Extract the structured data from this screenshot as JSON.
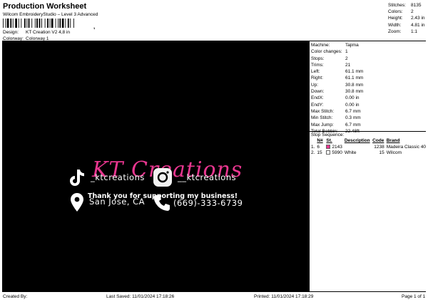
{
  "header": {
    "title": "Production Worksheet",
    "software": "Wilcom EmbroideryStudio – Level 3 Advanced",
    "barcode_mark": ",",
    "design_label": "Design:",
    "design_value": "KT Creation V2 4,8 in",
    "colorway_label": "Colorway:",
    "colorway_value": "Colorway 1"
  },
  "stats": [
    {
      "label": "Stitches:",
      "value": "8135"
    },
    {
      "label": "Colors:",
      "value": "2"
    },
    {
      "label": "Height:",
      "value": "2.43 in"
    },
    {
      "label": "Width:",
      "value": "4.81 in"
    },
    {
      "label": "Zoom:",
      "value": "1:1"
    }
  ],
  "machine": [
    {
      "label": "Machine:",
      "value": "Tajima"
    },
    {
      "label": "Color changes:",
      "value": "1"
    },
    {
      "label": "Stops:",
      "value": "2"
    },
    {
      "label": "Trims:",
      "value": "21"
    },
    {
      "label": "Left:",
      "value": "61.1 mm"
    },
    {
      "label": "Right:",
      "value": "61.1 mm"
    },
    {
      "label": "Up:",
      "value": "30.8 mm"
    },
    {
      "label": "Down:",
      "value": "30.8 mm"
    },
    {
      "label": "EndX:",
      "value": "0.00 in"
    },
    {
      "label": "EndY:",
      "value": "0.00 in"
    },
    {
      "label": "Max Stitch:",
      "value": "6.7 mm"
    },
    {
      "label": "Min Stitch:",
      "value": "0.3 mm"
    },
    {
      "label": "Max Jump:",
      "value": "6.7 mm"
    },
    {
      "label": "Total Bobbin:",
      "value": "22.48ft"
    }
  ],
  "stop_sequence": {
    "title": "Stop Sequence:",
    "headers": {
      "num": "N#",
      "st": "St.",
      "desc": "Description",
      "code": "Code",
      "brand": "Brand"
    },
    "rows": [
      {
        "index": "1.",
        "num": "6",
        "color": "#e8368f",
        "st": "2143",
        "desc": "",
        "code": "1238",
        "brand": "Madeira Classic 40"
      },
      {
        "index": "2.",
        "num": "15",
        "color": "#ffffff",
        "st": "5990",
        "desc": "White",
        "code": "15",
        "brand": "Wilcom"
      }
    ]
  },
  "design": {
    "script_title": "KT Creations",
    "thanks": "Thank you for supporting my business!",
    "tiktok": "_ktcreations",
    "instagram": "__ktcreations",
    "location": "San Jose, CA",
    "phone": "(669)-333-6739",
    "accent_color": "#e8368f"
  },
  "footer": {
    "created": "Created By:",
    "saved": "Last Saved: 11/01/2024 17:18:26",
    "printed": "Printed: 11/01/2024 17:18:29",
    "page": "Page 1 of 1"
  }
}
